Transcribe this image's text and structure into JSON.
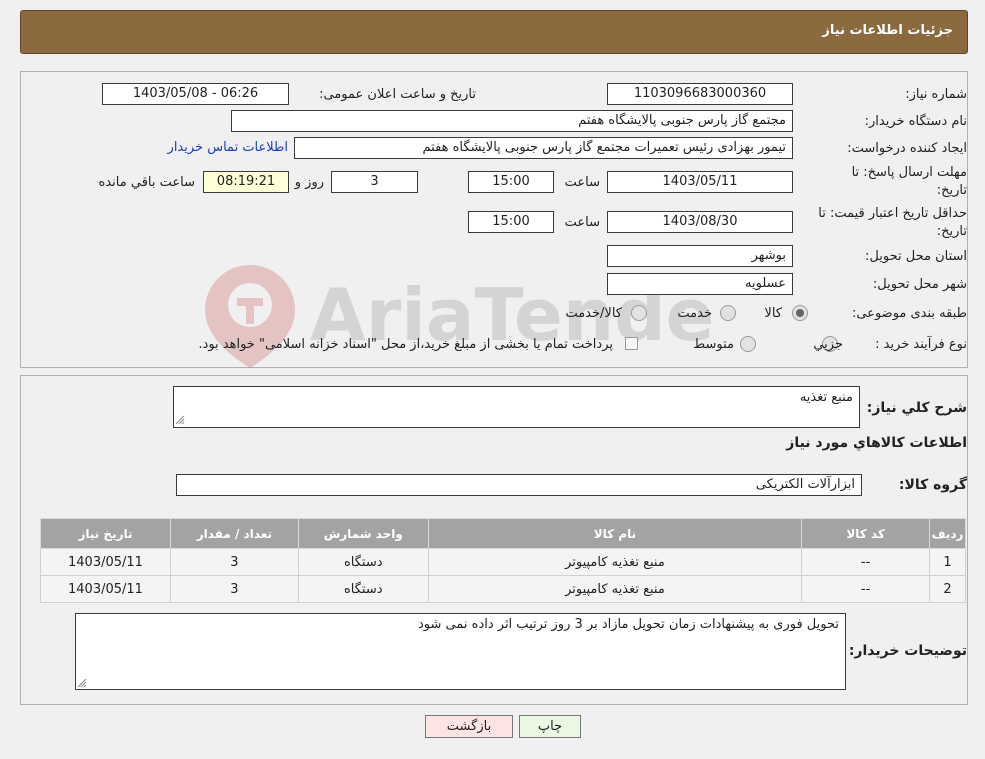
{
  "header": {
    "title": "جزئیات اطلاعات نیاز"
  },
  "watermark": {
    "text": "AriaTender.neT"
  },
  "form": {
    "need_number_label": "شماره نیاز:",
    "need_number": "1103096683000360",
    "announce_label": "تاریخ و ساعت اعلان عمومی:",
    "announce_value": "1403/05/08 - 06:26",
    "buyer_org_label": "نام دستگاه خریدار:",
    "buyer_org": "مجتمع گاز پارس جنوبی  پالایشگاه هفتم",
    "creator_label": "ایجاد کننده درخواست:",
    "creator": "تیمور بهزادی رئیس تعمیرات مجتمع گاز پارس جنوبی  پالایشگاه هفتم",
    "contact_link": "اطلاعات تماس خریدار",
    "deadline_label_1": "مهلت ارسال پاسخ: تا",
    "deadline_label_2": "تاریخ:",
    "deadline_date": "1403/05/11",
    "time_label": "ساعت",
    "deadline_time": "15:00",
    "days_value": "3",
    "days_label": "روز و",
    "remaining_time": "08:19:21",
    "remaining_label": "ساعت باقي مانده",
    "validity_label_1": "حداقل تاریخ اعتبار قیمت: تا",
    "validity_label_2": "تاریخ:",
    "validity_date": "1403/08/30",
    "validity_time": "15:00",
    "province_label": "استان محل تحویل:",
    "province": "بوشهر",
    "city_label": "شهر محل تحویل:",
    "city": "عسلویه",
    "category_label": "طبقه بندی موضوعی:",
    "category_options": [
      "کالا",
      "خدمت",
      "کالا/خدمت"
    ],
    "process_label": "نوع فرآیند خرید :",
    "process_options": [
      "جزیي",
      "متوسط"
    ],
    "payment_note": "پرداخت تمام یا بخشی از مبلغ خرید،از محل \"اسناد خزانه اسلامی\" خواهد بود."
  },
  "details": {
    "summary_label": "شرح كلي نياز:",
    "summary": "منبع تغذیه",
    "goods_info_title": "اطلاعات كالاهاي مورد نياز",
    "group_label": "گروه کالا:",
    "group": "ابزارآلات الکتریکی",
    "table": {
      "headers": [
        "رديف",
        "كد كالا",
        "نام كالا",
        "واحد شمارش",
        "تعداد / مقدار",
        "تاریخ نیاز"
      ],
      "rows": [
        [
          "1",
          "--",
          "منبع تغذیه کامپیوتر",
          "دستگاه",
          "3",
          "1403/05/11"
        ],
        [
          "2",
          "--",
          "منبع تغذیه کامپیوتر",
          "دستگاه",
          "3",
          "1403/05/11"
        ]
      ]
    },
    "buyer_notes_label": "توضیحات خریدار:",
    "buyer_notes": "تحویل فوری به پیشنهادات زمان تحویل مازاد بر 3 روز ترتیب اثر داده نمی شود"
  },
  "buttons": {
    "print": "چاپ",
    "back": "بازگشت"
  },
  "colors": {
    "header": "#8b6a3f",
    "back_button": "#fde3e3",
    "print_button": "#eaf7e3",
    "link": "#1a3fbf"
  }
}
